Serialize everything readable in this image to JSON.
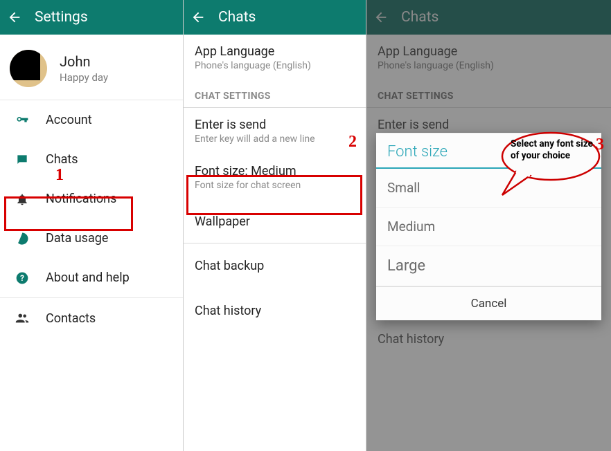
{
  "panel1": {
    "title": "Settings",
    "profile": {
      "name": "John",
      "status": "Happy day"
    },
    "items": [
      {
        "label": "Account"
      },
      {
        "label": "Chats"
      },
      {
        "label": "Notifications"
      },
      {
        "label": "Data usage"
      },
      {
        "label": "About and help"
      },
      {
        "label": "Contacts"
      }
    ],
    "step_number": "1"
  },
  "panel2": {
    "title": "Chats",
    "app_language": {
      "title": "App Language",
      "sub": "Phone's language (English)"
    },
    "section": "CHAT SETTINGS",
    "enter_is_send": {
      "title": "Enter is send",
      "sub": "Enter key will add a new line"
    },
    "font_size": {
      "title": "Font size: Medium",
      "sub": "Font size for chat screen"
    },
    "wallpaper": "Wallpaper",
    "chat_backup": "Chat backup",
    "chat_history": "Chat history",
    "step_number": "2"
  },
  "panel3": {
    "title": "Chats",
    "app_language": {
      "title": "App Language",
      "sub": "Phone's language (English)"
    },
    "section": "CHAT SETTINGS",
    "enter_is_send_title": "Enter is send",
    "chat_history": "Chat history",
    "dialog": {
      "title": "Font size",
      "options": [
        "Small",
        "Medium",
        "Large"
      ],
      "cancel": "Cancel"
    },
    "annotation": "Select any font size of your choice",
    "step_number": "3"
  }
}
